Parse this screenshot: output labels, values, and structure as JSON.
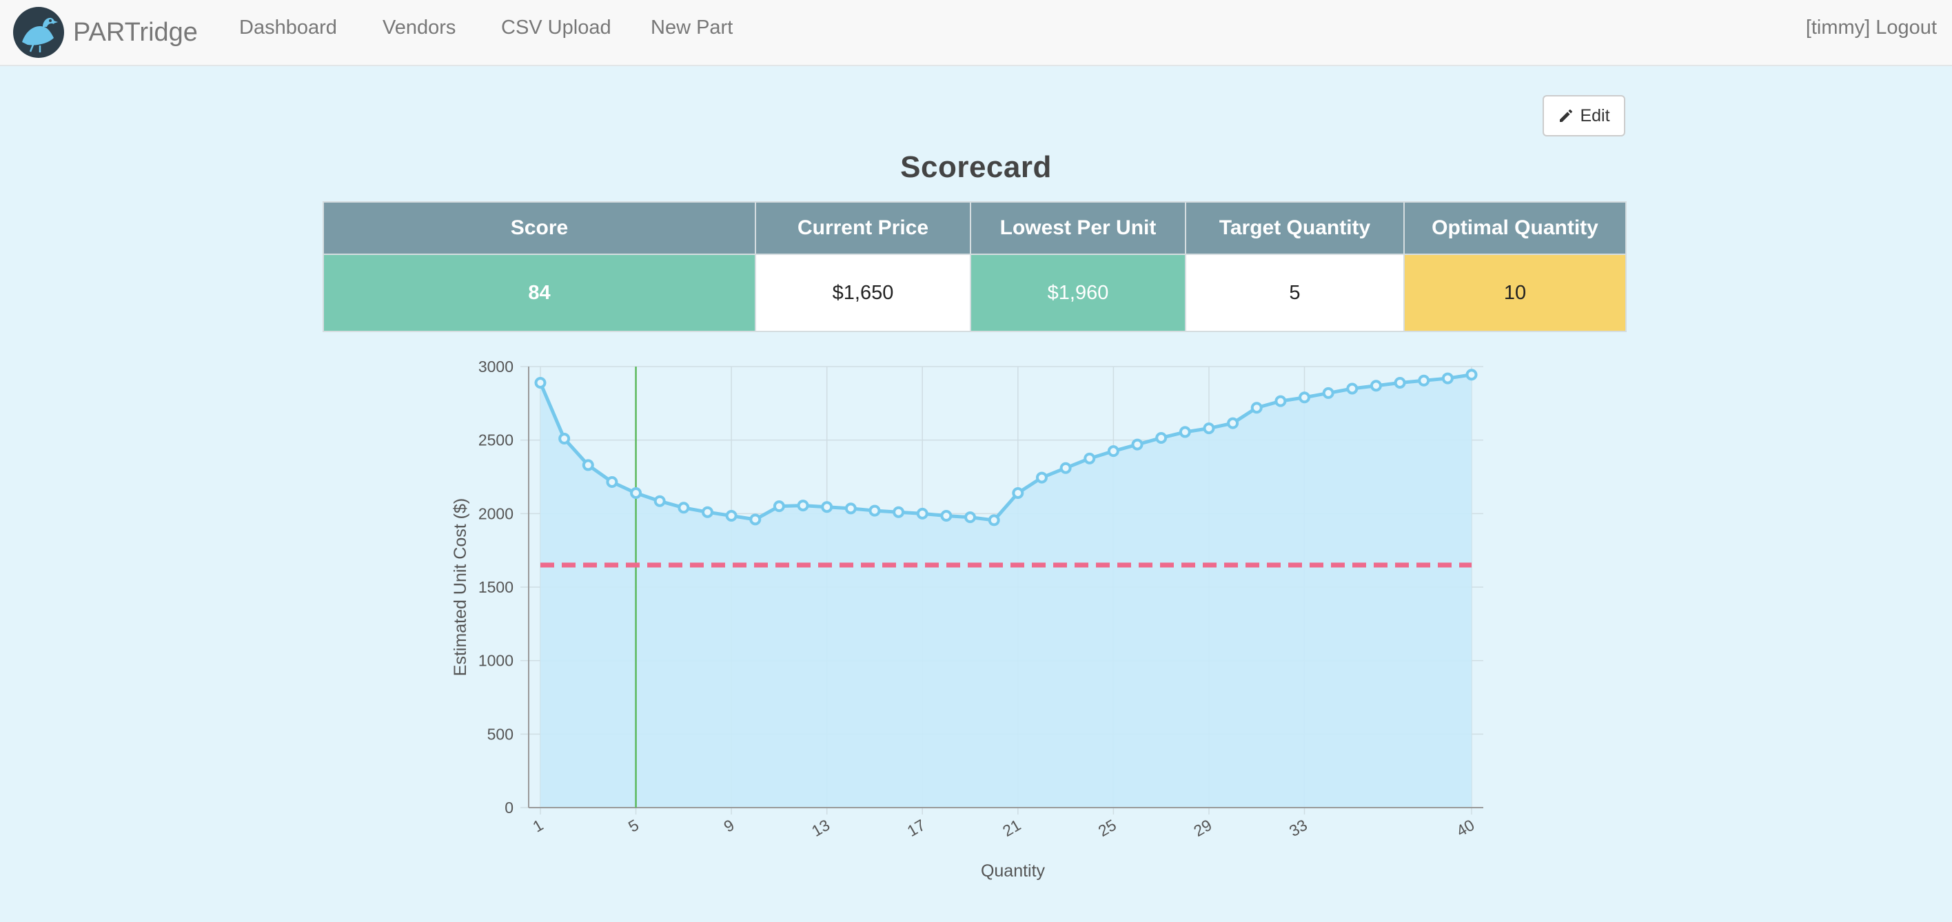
{
  "nav": {
    "brand": "PARTridge",
    "links": [
      "Dashboard",
      "Vendors",
      "CSV Upload",
      "New Part"
    ],
    "user": "[timmy] Logout"
  },
  "edit_label": "Edit",
  "scorecard": {
    "title": "Scorecard",
    "headers": [
      "Score",
      "Current Price",
      "Lowest Per Unit",
      "Target Quantity",
      "Optimal Quantity"
    ],
    "values": [
      "84",
      "$1,650",
      "$1,960",
      "5",
      "10"
    ]
  },
  "colors": {
    "teal": "#79c9b2",
    "yellow": "#f7d46b",
    "header": "#7a9aa6",
    "line": "#75c8ec",
    "fill": "#c8eaf9",
    "current_price_line": "#ee6a8c",
    "target_line": "#5cb85c"
  },
  "chart_data": {
    "type": "line",
    "xlabel": "Quantity",
    "ylabel": "Estimated Unit Cost ($)",
    "ylim": [
      0,
      3000
    ],
    "yticks": [
      0,
      500,
      1000,
      1500,
      2000,
      2500,
      3000
    ],
    "xticks": [
      1,
      5,
      9,
      13,
      17,
      21,
      25,
      29,
      33,
      40
    ],
    "grid": true,
    "x": [
      1,
      2,
      3,
      4,
      5,
      6,
      7,
      8,
      9,
      10,
      11,
      12,
      13,
      14,
      15,
      16,
      17,
      18,
      19,
      20,
      21,
      22,
      23,
      24,
      25,
      26,
      27,
      28,
      29,
      30,
      31,
      32,
      33,
      34,
      35,
      36,
      37,
      38,
      39,
      40
    ],
    "series": [
      {
        "values": [
          2890,
          2510,
          2330,
          2215,
          2140,
          2085,
          2040,
          2010,
          1985,
          1960,
          2050,
          2055,
          2045,
          2035,
          2020,
          2010,
          2000,
          1985,
          1975,
          1955,
          2140,
          2245,
          2310,
          2375,
          2425,
          2470,
          2515,
          2555,
          2580,
          2615,
          2720,
          2765,
          2790,
          2820,
          2850,
          2870,
          2890,
          2905,
          2920,
          2945
        ],
        "fill": true
      }
    ],
    "reference_lines": {
      "current_price": 1650,
      "target_quantity": 5
    }
  }
}
